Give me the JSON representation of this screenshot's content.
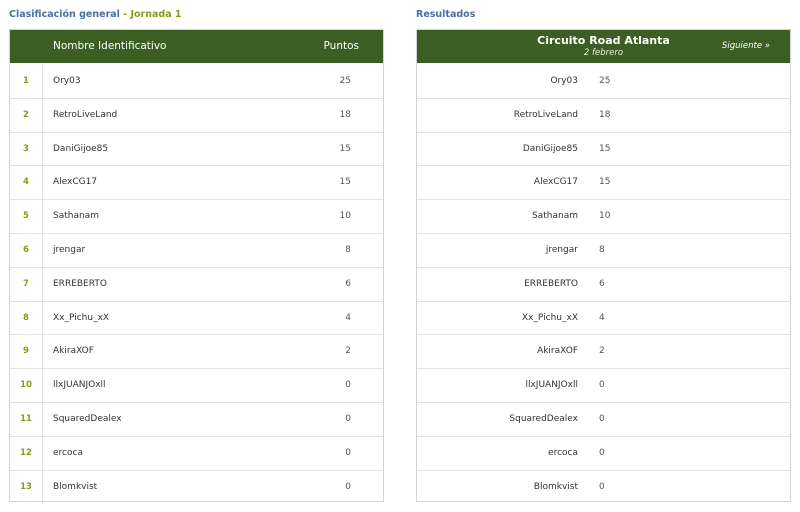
{
  "left": {
    "title_main": "Clasificación general",
    "title_sep": " - ",
    "title_accent": "Jornada 1",
    "col_name": "Nombre Identificativo",
    "col_points": "Puntos",
    "rows": [
      {
        "pos": "1",
        "name": "Ory03",
        "points": "25"
      },
      {
        "pos": "2",
        "name": "RetroLiveLand",
        "points": "18"
      },
      {
        "pos": "3",
        "name": "DaniGijoe85",
        "points": "15"
      },
      {
        "pos": "4",
        "name": "AlexCG17",
        "points": "15"
      },
      {
        "pos": "5",
        "name": "Sathanam",
        "points": "10"
      },
      {
        "pos": "6",
        "name": "jrengar",
        "points": "8"
      },
      {
        "pos": "7",
        "name": "ERREBERTO",
        "points": "6"
      },
      {
        "pos": "8",
        "name": "Xx_Pichu_xX",
        "points": "4"
      },
      {
        "pos": "9",
        "name": "AkiraXOF",
        "points": "2"
      },
      {
        "pos": "10",
        "name": "llxJUANJOxll",
        "points": "0"
      },
      {
        "pos": "11",
        "name": "SquaredDealex",
        "points": "0"
      },
      {
        "pos": "12",
        "name": "ercoca",
        "points": "0"
      },
      {
        "pos": "13",
        "name": "Blomkvist",
        "points": "0"
      }
    ]
  },
  "right": {
    "title": "Resultados",
    "race_name": "Circuito Road Atlanta",
    "race_date": "2 febrero",
    "next_label": "Siguiente »",
    "rows": [
      {
        "name": "Ory03",
        "points": "25"
      },
      {
        "name": "RetroLiveLand",
        "points": "18"
      },
      {
        "name": "DaniGijoe85",
        "points": "15"
      },
      {
        "name": "AlexCG17",
        "points": "15"
      },
      {
        "name": "Sathanam",
        "points": "10"
      },
      {
        "name": "jrengar",
        "points": "8"
      },
      {
        "name": "ERREBERTO",
        "points": "6"
      },
      {
        "name": "Xx_Pichu_xX",
        "points": "4"
      },
      {
        "name": "AkiraXOF",
        "points": "2"
      },
      {
        "name": "llxJUANJOxll",
        "points": "0"
      },
      {
        "name": "SquaredDealex",
        "points": "0"
      },
      {
        "name": "ercoca",
        "points": "0"
      },
      {
        "name": "Blomkvist",
        "points": "0"
      }
    ]
  }
}
